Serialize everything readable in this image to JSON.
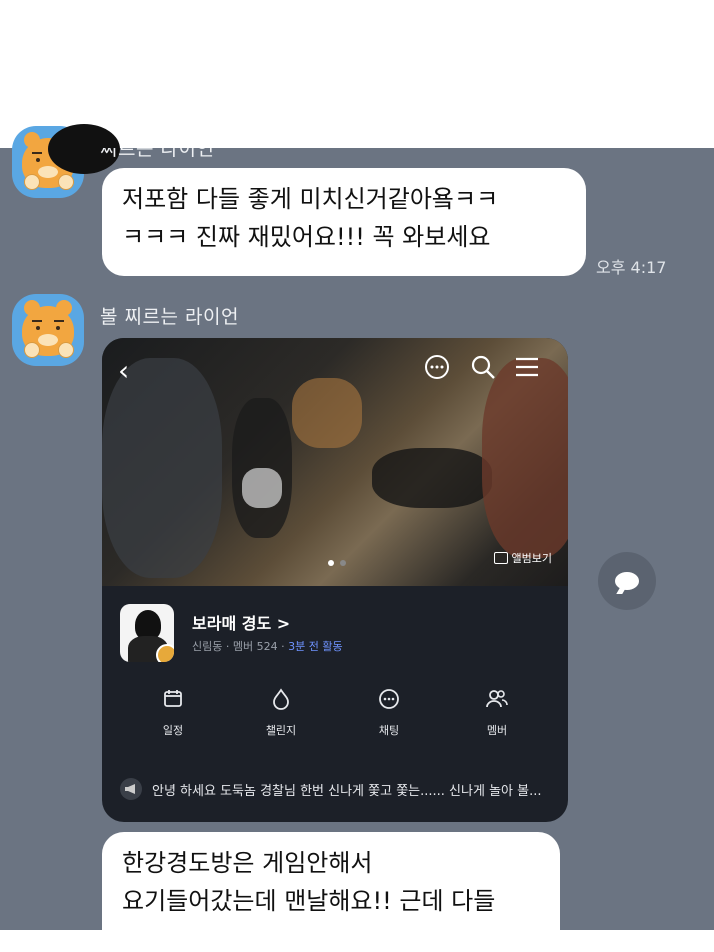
{
  "messages": [
    {
      "sender": "찌르는 라이언",
      "text_lines": [
        "저포함 다들 좋게 미치신거같아욬ㅋㅋ",
        "ㅋㅋㅋ 진짜 재밌어요!!! 꼭 와보세요"
      ],
      "time": "오후 4:17"
    },
    {
      "sender": "볼 찌르는 라이언",
      "card": {
        "album_label": "앨범보기",
        "club_name": "보라매 경도 >",
        "meta_location": "신림동",
        "meta_members": "멤버 524",
        "meta_activity": "3분 전 활동",
        "menu": [
          {
            "label": "일정",
            "icon": "calendar-icon"
          },
          {
            "label": "챌린지",
            "icon": "challenge-icon"
          },
          {
            "label": "채팅",
            "icon": "chat-icon"
          },
          {
            "label": "멤버",
            "icon": "members-icon"
          }
        ],
        "notice": "안녕 하세요 도둑놈 경찰님 한번 신나게 쫓고 쫓는...... 신나게 놀아 볼..."
      }
    },
    {
      "text_lines": [
        "한강경도방은 게임안해서",
        "요기들어갔는데 맨날해요!! 근데 다들"
      ]
    }
  ],
  "icons": {
    "back": "chevron-left-icon",
    "chat": "chat-bubble-icon",
    "search": "search-icon",
    "menu": "hamburger-icon",
    "share": "share-icon"
  },
  "colors": {
    "chat_bg": "#6b7482",
    "bubble": "#ffffff",
    "card_bg": "#1c2028",
    "accent_activity": "#6f93ff"
  }
}
